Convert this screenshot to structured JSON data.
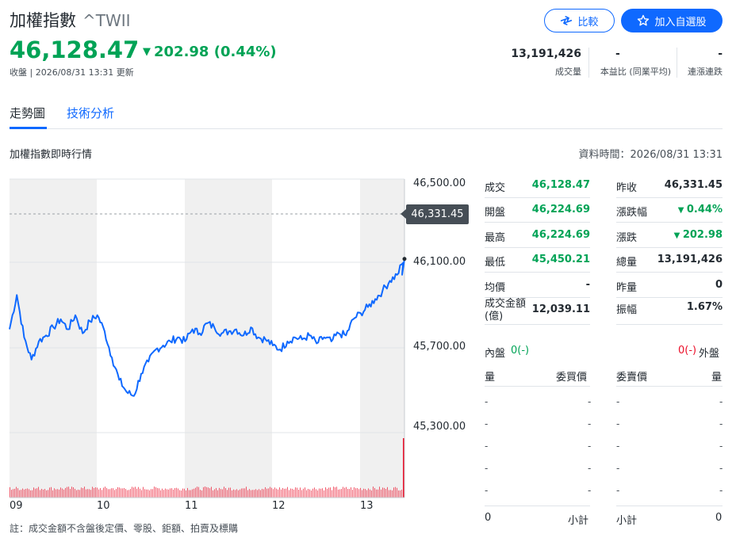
{
  "header": {
    "name": "加權指數",
    "symbol": "^TWII",
    "price": "46,128.47",
    "change": "202.98 (0.44%)",
    "time_info": "收盤 | 2026/08/31 13:31 更新",
    "compare_label": "比較",
    "add_watchlist_label": "加入自選股"
  },
  "stats": [
    {
      "value": "13,191,426",
      "label": "成交量"
    },
    {
      "value": "-",
      "label": "本益比 (同業平均)"
    },
    {
      "value": "-",
      "label": "連漲連跌"
    }
  ],
  "tabs": [
    "走勢圖",
    "技術分析"
  ],
  "section": {
    "title": "加權指數即時行情",
    "data_time": "資料時間：2026/08/31 13:31"
  },
  "chart": {
    "y_ticks": [
      "46,500.00",
      "46,100.00",
      "45,700.00",
      "45,300.00"
    ],
    "prev_close_tag": "46,331.45",
    "x_ticks": [
      "09",
      "10",
      "11",
      "12",
      "13"
    ],
    "note": "註：成交金額不含盤後定價、零股、鉅額、拍賣及標購",
    "line_color": "#0f69ff",
    "volume_color": "#eb0f29"
  },
  "chart_data": {
    "type": "line",
    "x_ticks": [
      "09",
      "10",
      "11",
      "12",
      "13"
    ],
    "y_ticks": [
      46500,
      46100,
      45700,
      45300
    ],
    "ylim": [
      45000,
      46500
    ],
    "prev_close": 46331.45,
    "session": [
      "09:00",
      "13:30"
    ],
    "series": [
      {
        "x": [
          "09:00",
          "09:05",
          "09:10",
          "09:15",
          "09:20",
          "09:25",
          "09:30",
          "09:35",
          "09:40",
          "09:45",
          "09:50",
          "09:55",
          "10:00",
          "10:05",
          "10:10",
          "10:15",
          "10:20",
          "10:25",
          "10:30",
          "10:35",
          "10:40",
          "10:45",
          "10:50",
          "10:55",
          "11:00",
          "11:05",
          "11:10",
          "11:15",
          "11:20",
          "11:25",
          "11:30",
          "11:35",
          "11:40",
          "11:45",
          "11:50",
          "11:55",
          "12:00",
          "12:05",
          "12:10",
          "12:15",
          "12:20",
          "12:25",
          "12:30",
          "12:35",
          "12:40",
          "12:45",
          "12:50",
          "12:55",
          "13:00",
          "13:05",
          "13:10",
          "13:15",
          "13:20",
          "13:25",
          "13:30"
        ],
        "y": [
          45780,
          45950,
          45740,
          45630,
          45720,
          45750,
          45790,
          45830,
          45780,
          45850,
          45760,
          45820,
          45850,
          45770,
          45640,
          45530,
          45470,
          45450,
          45560,
          45620,
          45680,
          45700,
          45720,
          45740,
          45720,
          45780,
          45760,
          45810,
          45790,
          45760,
          45770,
          45780,
          45750,
          45790,
          45740,
          45730,
          45700,
          45680,
          45720,
          45740,
          45730,
          45750,
          45710,
          45740,
          45720,
          45760,
          45750,
          45830,
          45860,
          45890,
          45930,
          45970,
          46020,
          46050,
          46128.47
        ]
      }
    ]
  },
  "quote_left": [
    {
      "label": "成交",
      "value": "46,128.47",
      "color": "green"
    },
    {
      "label": "開盤",
      "value": "46,224.69",
      "color": "green"
    },
    {
      "label": "最高",
      "value": "46,224.69",
      "color": "green"
    },
    {
      "label": "最低",
      "value": "45,450.21",
      "color": "green"
    },
    {
      "label": "均價",
      "value": "-",
      "color": "dark"
    },
    {
      "label": "成交金額 (億)",
      "value": "12,039.11",
      "color": "dark"
    }
  ],
  "quote_right": [
    {
      "label": "昨收",
      "value": "46,331.45",
      "color": "dark"
    },
    {
      "label": "漲跌幅",
      "value": "0.44%",
      "color": "green",
      "arrow": true
    },
    {
      "label": "漲跌",
      "value": "202.98",
      "color": "green",
      "arrow": true
    },
    {
      "label": "總量",
      "value": "13,191,426",
      "color": "dark"
    },
    {
      "label": "昨量",
      "value": "0",
      "color": "dark"
    },
    {
      "label": "振幅",
      "value": "1.67%",
      "color": "dark"
    }
  ],
  "orderbook": {
    "inner_label": "內盤",
    "inner_value": "0(-)",
    "outer_label": "外盤",
    "outer_value": "0(-)",
    "col_qty": "量",
    "col_bid": "委買價",
    "col_ask": "委賣價",
    "col_qty2": "量",
    "row_dash": "-",
    "rows": 5,
    "footer_qty": "0",
    "footer_subtotal": "小計",
    "footer_subtotal2": "小計",
    "footer_qty2": "0"
  }
}
